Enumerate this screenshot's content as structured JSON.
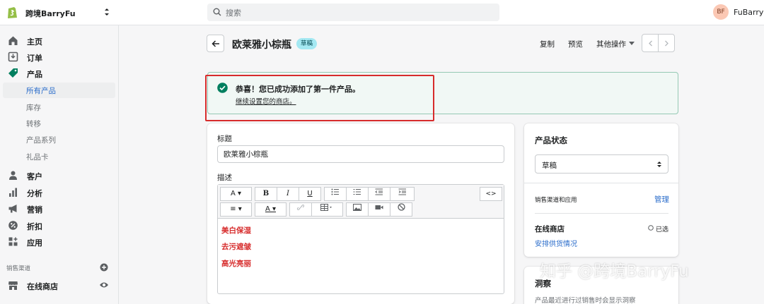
{
  "topbar": {
    "store_name": "跨境BarryFu",
    "search_placeholder": "搜索",
    "avatar_initials": "BF",
    "user_name": "FuBarry"
  },
  "sidebar": {
    "items": [
      {
        "label": "主页",
        "icon": "home-icon"
      },
      {
        "label": "订单",
        "icon": "orders-icon"
      },
      {
        "label": "产品",
        "icon": "tag-icon"
      }
    ],
    "sub_items": [
      {
        "label": "所有产品",
        "active": true
      },
      {
        "label": "库存"
      },
      {
        "label": "转移"
      },
      {
        "label": "产品系列"
      },
      {
        "label": "礼品卡"
      }
    ],
    "items2": [
      {
        "label": "客户",
        "icon": "person-icon"
      },
      {
        "label": "分析",
        "icon": "bar-chart-icon"
      },
      {
        "label": "营销",
        "icon": "megaphone-icon"
      },
      {
        "label": "折扣",
        "icon": "discount-icon"
      },
      {
        "label": "应用",
        "icon": "apps-icon"
      }
    ],
    "channels_title": "销售渠道",
    "online_store": "在线商店"
  },
  "header": {
    "title": "欧莱雅小棕瓶",
    "badge": "草稿",
    "actions": {
      "duplicate": "复制",
      "preview": "预览",
      "more": "其他操作"
    }
  },
  "banner": {
    "title": "恭喜！您已成功添加了第一件产品。",
    "link": "继续设置您的商店。"
  },
  "product": {
    "title_label": "标题",
    "title_value": "欧莱雅小棕瓶",
    "description_label": "描述",
    "description_lines": [
      "美白保湿",
      "去污遮皱",
      "高光亮丽"
    ]
  },
  "status_card": {
    "title": "产品状态",
    "status_value": "草稿",
    "channels_label": "销售渠道和应用",
    "manage": "管理",
    "online_store": "在线商店",
    "selected": "已选",
    "schedule_link": "安排供货情况"
  },
  "insights_card": {
    "title": "洞察",
    "text": "产品最近进行过销售时会显示洞察"
  },
  "watermark": "知乎 @跨境BarryFu",
  "colors": {
    "accent": "#2c6ecb",
    "success": "#007f5f",
    "highlight": "#d72c2c",
    "badge": "#a4e8f2"
  }
}
